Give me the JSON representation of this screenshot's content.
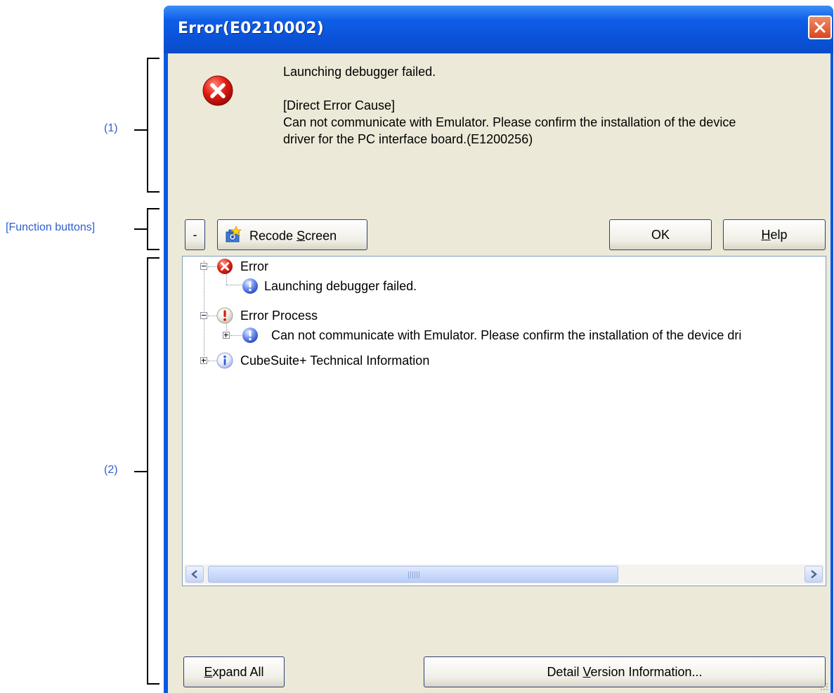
{
  "annotations": {
    "region1": "(1)",
    "function_buttons": "[Function buttons]",
    "region2": "(2)"
  },
  "window": {
    "title": "Error(E0210002)"
  },
  "message": {
    "line1": "Launching debugger failed.",
    "cause_header": "[Direct Error Cause]",
    "cause_line1": "Can not communicate with Emulator. Please confirm the installation of the device",
    "cause_line2": "driver for the PC interface board.(E1200256)"
  },
  "toolbar": {
    "collapse_label": "-",
    "record_pre": "Recode ",
    "record_mnemonic": "S",
    "record_post": "creen",
    "ok_label": "OK",
    "help_mnemonic": "H",
    "help_post": "elp"
  },
  "tree": {
    "items": [
      {
        "label": "Error"
      },
      {
        "label": "Launching debugger failed."
      },
      {
        "label": "Error Process"
      },
      {
        "label": "Can not communicate with Emulator. Please confirm the installation of the device dri"
      },
      {
        "label": "CubeSuite+ Technical Information"
      }
    ]
  },
  "bottom": {
    "expand_mnemonic": "E",
    "expand_post": "xpand All",
    "detail_pre": "Detail ",
    "detail_mnemonic": "V",
    "detail_post": "ersion Information..."
  },
  "colors": {
    "titlebar": "#0a58e0",
    "client": "#ece9d8",
    "annotation": "#2f5fd0"
  }
}
